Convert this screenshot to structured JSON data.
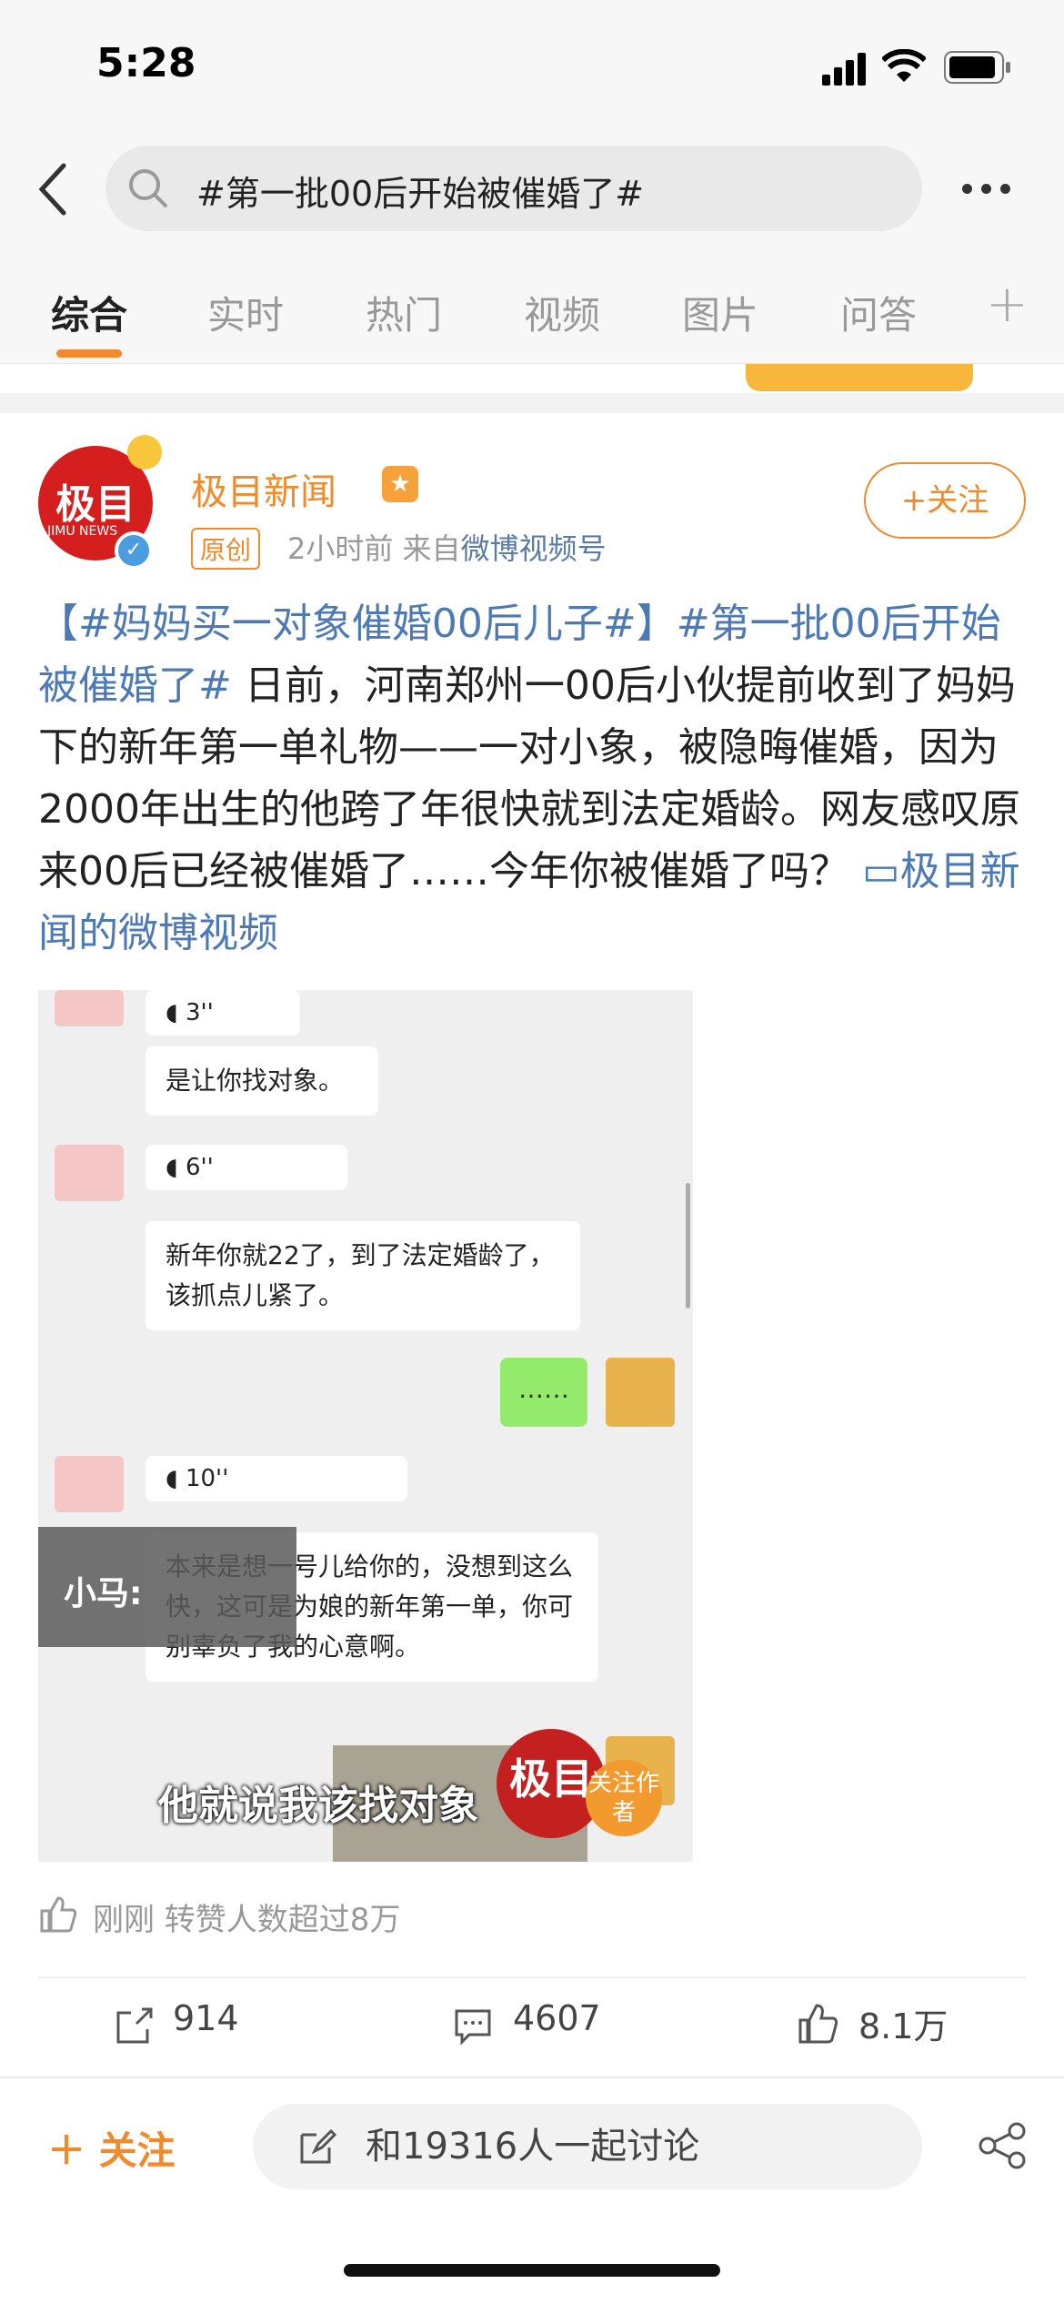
{
  "status": {
    "time": "5:28"
  },
  "search": {
    "query": "#第一批00后开始被催婚了#"
  },
  "tabs": [
    "综合",
    "实时",
    "热门",
    "视频",
    "图片",
    "问答"
  ],
  "post": {
    "author": "极目新闻",
    "original_tag": "原创",
    "time_ago": "2小时前",
    "source_prefix": "来自",
    "source": "微博视频号",
    "follow_label": "+关注",
    "hashtag1": "【#妈妈买一对象催婚00后儿子#】",
    "hashtag2": "#第一批00后开始被催婚了#",
    "body": "日前，河南郑州一00后小伙提前收到了妈妈下的新年第一单礼物——一对小象，被隐晦催婚，因为2000年出生的他跨了年很快就到法定婚龄。网友感叹原来00后已经被催婚了……今年你被催婚了吗？",
    "video_link": "极目新闻的微博视频"
  },
  "video": {
    "voice1": "3''",
    "msg1": "是让你找对象。",
    "voice2": "6''",
    "msg2": "新年你就22了，到了法定婚龄了，该抓点儿紧了。",
    "reply": "……",
    "voice3": "10''",
    "msg3": "本来是想一号儿给你的，没想到这么快，这可是为娘的新年第一单，你可别辜负了我的心意啊。",
    "overlay_name": "小马:",
    "subtitle": "他就说我该找对象",
    "watermark": "极目",
    "watermark_sub": "JIMU NEWS",
    "watermark_follow": "关注作者"
  },
  "repost_info": "刚刚 转赞人数超过8万",
  "actions": {
    "reposts": "914",
    "comments": "4607",
    "likes": "8.1万"
  },
  "bottom": {
    "follow": "关注",
    "discuss": "和19316人一起讨论"
  }
}
